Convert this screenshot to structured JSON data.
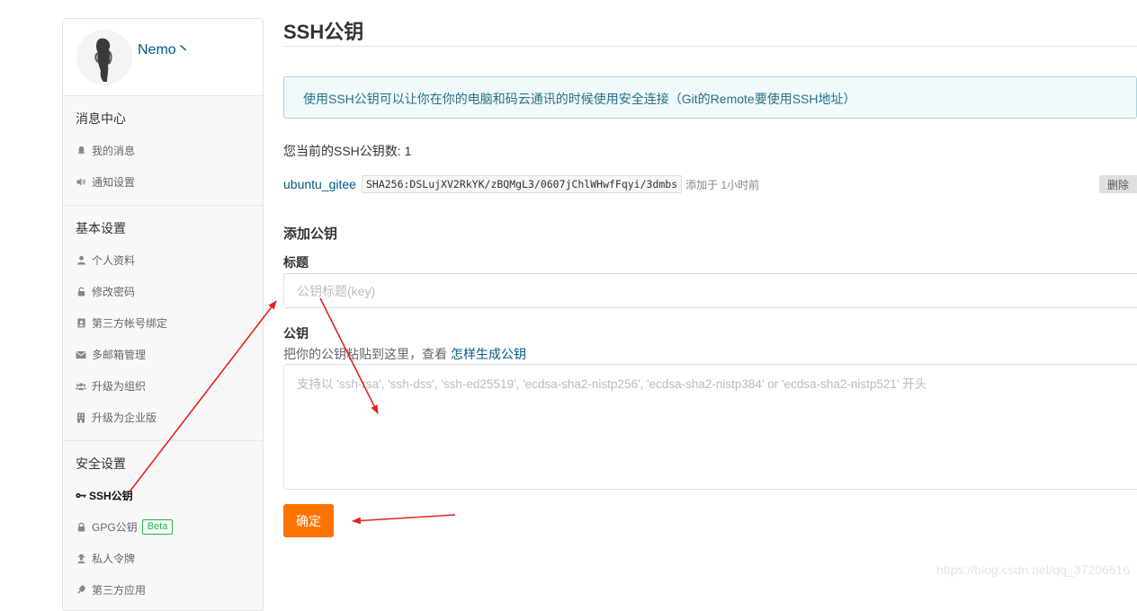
{
  "profile": {
    "username": "Nemo丶"
  },
  "sidebar": {
    "sections": [
      {
        "title": "消息中心",
        "items": [
          {
            "label": "我的消息",
            "icon": "bell-icon"
          },
          {
            "label": "通知设置",
            "icon": "volume-icon"
          }
        ]
      },
      {
        "title": "基本设置",
        "items": [
          {
            "label": "个人资料",
            "icon": "user-icon"
          },
          {
            "label": "修改密码",
            "icon": "unlock-icon"
          },
          {
            "label": "第三方帐号绑定",
            "icon": "id-card-icon"
          },
          {
            "label": "多邮箱管理",
            "icon": "envelope-icon"
          },
          {
            "label": "升级为组织",
            "icon": "users-icon"
          },
          {
            "label": "升级为企业版",
            "icon": "building-icon"
          }
        ]
      },
      {
        "title": "安全设置",
        "items": [
          {
            "label": "SSH公钥",
            "icon": "key-icon",
            "active": true
          },
          {
            "label": "GPG公钥",
            "icon": "lock-icon",
            "badge": "Beta"
          },
          {
            "label": "私人令牌",
            "icon": "user-secret-icon"
          },
          {
            "label": "第三方应用",
            "icon": "plug-icon"
          }
        ]
      }
    ]
  },
  "main": {
    "title": "SSH公钥",
    "notice": "使用SSH公钥可以让你在你的电脑和码云通讯的时候使用安全连接（Git的Remote要使用SSH地址）",
    "count_text": "您当前的SSH公钥数: 1",
    "keys": [
      {
        "name": "ubuntu_gitee",
        "fingerprint": "SHA256:DSLujXV2RkYK/zBQMgL3/0607jChlWHwfFqyi/3dmbs",
        "time": "添加于 1小时前",
        "delete_label": "删除"
      }
    ],
    "add_title": "添加公钥",
    "title_label": "标题",
    "title_placeholder": "公钥标题(key)",
    "key_label": "公钥",
    "key_hint": "把你的公钥粘贴到这里，查看",
    "key_hint_link": "怎样生成公钥",
    "key_placeholder": "支持以 'ssh-rsa', 'ssh-dss', 'ssh-ed25519', 'ecdsa-sha2-nistp256', 'ecdsa-sha2-nistp384' or 'ecdsa-sha2-nistp521' 开头",
    "submit_label": "确定"
  },
  "watermark": "https://blog.csdn.net/qq_37206616",
  "colors": {
    "accent": "#fe7300",
    "link": "#005980",
    "annotation": "#e8211f"
  }
}
